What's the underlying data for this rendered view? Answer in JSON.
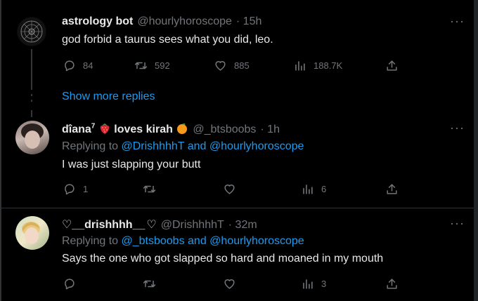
{
  "colors": {
    "background": "#000000",
    "text": "#e7e9ea",
    "muted": "#71767b",
    "accent": "#1d9bf0",
    "divider": "#2f3336"
  },
  "tweet1": {
    "name": "astrology bot",
    "handle": "@hourlyhoroscope",
    "time": "· 15h",
    "text": "god forbid a taurus sees what you did, leo.",
    "more": "···",
    "counts": {
      "reply": "84",
      "retweet": "592",
      "like": "885",
      "views": "188.7K"
    }
  },
  "show_more": "Show more replies",
  "tweet2": {
    "name_part1": "dîana",
    "superscript": "7",
    "name_part2": "loves kirah",
    "handle": "@_btsboobs",
    "time": "· 1h",
    "replying_prefix": "Replying to",
    "replying_users": "@DrishhhhT and @hourlyhoroscope",
    "text": "I was just slapping your butt",
    "more": "···",
    "counts": {
      "reply": "1",
      "views": "6"
    }
  },
  "tweet3": {
    "heart_left": "♡",
    "name": "__drishhhh__",
    "heart_right": "♡",
    "handle": "@DrishhhhT",
    "time": "· 32m",
    "replying_prefix": "Replying to",
    "replying_users": "@_btsboobs and @hourlyhoroscope",
    "text": "Says the one who got slapped so hard and moaned in my mouth",
    "more": "···",
    "counts": {
      "views": "3"
    }
  }
}
